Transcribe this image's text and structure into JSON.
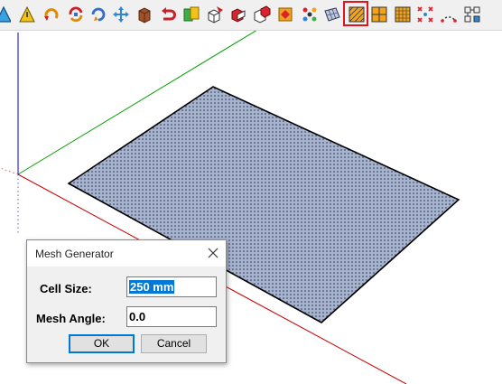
{
  "toolbar": {
    "tools": [
      {
        "name": "drape-icon",
        "selected": false
      },
      {
        "name": "warning-triangle-icon",
        "selected": false
      },
      {
        "name": "rotate-arrow-icon",
        "selected": false
      },
      {
        "name": "refresh-arrows-icon",
        "selected": false
      },
      {
        "name": "cycle-arrows-icon",
        "selected": false
      },
      {
        "name": "move-cross-icon",
        "selected": false
      },
      {
        "name": "box-icon",
        "selected": false
      },
      {
        "name": "undo-curve-icon",
        "selected": false
      },
      {
        "name": "pages-icon",
        "selected": false
      },
      {
        "name": "edit-cube-icon",
        "selected": false
      },
      {
        "name": "red-cube-icon",
        "selected": false
      },
      {
        "name": "split-cube-icon",
        "selected": false
      },
      {
        "name": "orange-diamond-icon",
        "selected": false
      },
      {
        "name": "cluster-icon",
        "selected": false
      },
      {
        "name": "flat-grid-icon",
        "selected": false
      },
      {
        "name": "mesh-generator-icon",
        "selected": true
      },
      {
        "name": "quad-grid-icon",
        "selected": false
      },
      {
        "name": "fine-grid-icon",
        "selected": false
      },
      {
        "name": "scatter-points-icon",
        "selected": false
      },
      {
        "name": "dotted-arc-icon",
        "selected": false
      },
      {
        "name": "node-grid-icon",
        "selected": false
      }
    ]
  },
  "colors": {
    "selection_highlight": "#e0141e",
    "surface_fill": "#a6b4d0",
    "axis_red": "#cc0000",
    "axis_green": "#00a000",
    "axis_blue": "#0000cc",
    "accent_blue": "#0078d7"
  },
  "dialog": {
    "title": "Mesh Generator",
    "cell_size_label": "Cell Size:",
    "cell_size_value": "250 mm",
    "mesh_angle_label": "Mesh Angle:",
    "mesh_angle_value": "0.0",
    "ok_label": "OK",
    "cancel_label": "Cancel"
  }
}
